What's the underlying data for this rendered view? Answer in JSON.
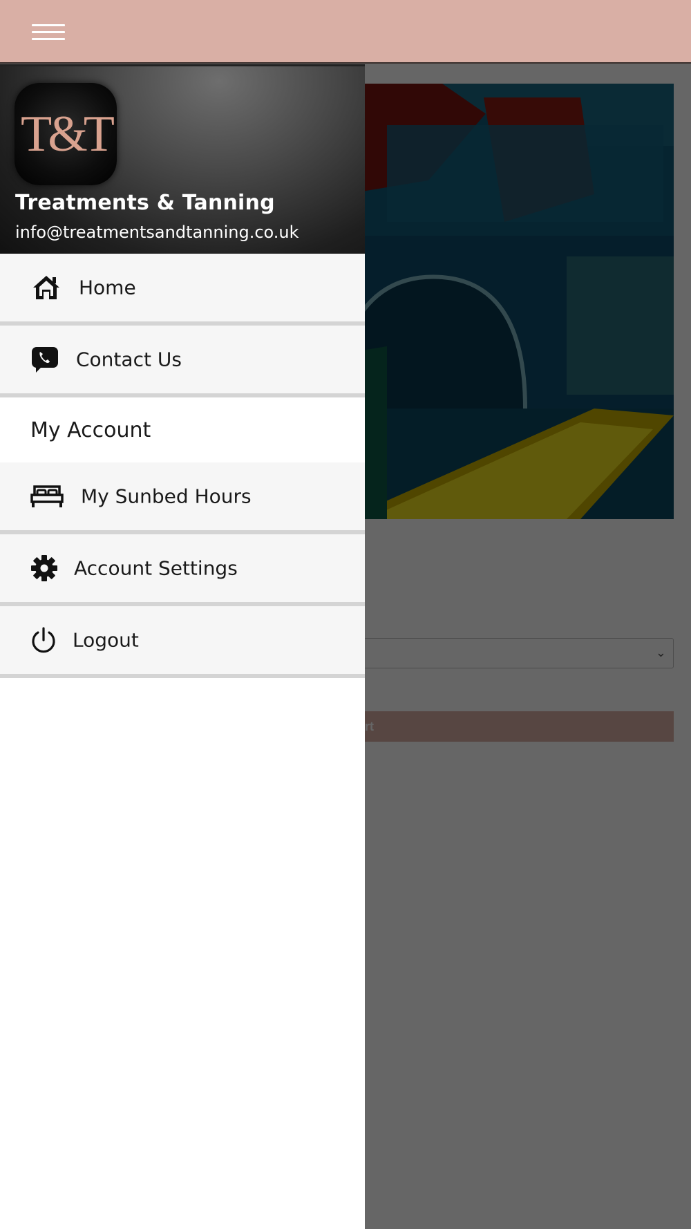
{
  "appbar": {
    "menu_icon": "hamburger-menu-icon",
    "color": "#d9afa5"
  },
  "page": {
    "cta_partial_text": "art",
    "select_chevron": "⌄"
  },
  "drawer": {
    "logo_text": "T&T",
    "brand_name": "Treatments & Tanning",
    "email": "info@treatmentsandtanning.co.uk",
    "items": [
      {
        "label": "Home",
        "icon": "home-icon"
      },
      {
        "label": "Contact Us",
        "icon": "phone-chat-icon"
      }
    ],
    "section_title": "My Account",
    "account_items": [
      {
        "label": "My Sunbed Hours",
        "icon": "bed-icon"
      },
      {
        "label": "Account Settings",
        "icon": "gear-icon"
      },
      {
        "label": "Logout",
        "icon": "power-icon"
      }
    ]
  }
}
